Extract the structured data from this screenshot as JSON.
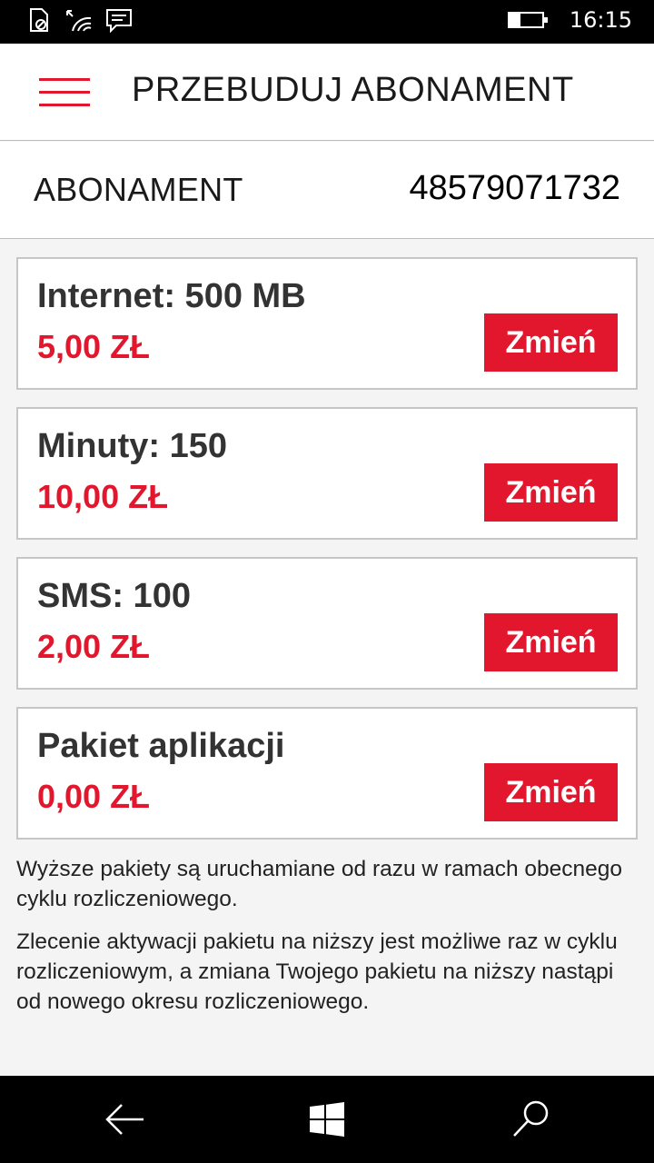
{
  "status_bar": {
    "time": "16:15",
    "battery_level": 0.35,
    "icons": [
      "do-not-disturb-icon",
      "wifi-icon",
      "message-icon"
    ]
  },
  "header": {
    "title": "PRZEBUDUJ ABONAMENT",
    "menu_icon": "hamburger-menu-icon",
    "accent_color": "#e2162d"
  },
  "subscription": {
    "label": "ABONAMENT",
    "number": "48579071732"
  },
  "packages": [
    {
      "name": "Internet: 500 MB",
      "price": "5,00 ZŁ",
      "button_label": "Zmień"
    },
    {
      "name": "Minuty: 150",
      "price": "10,00 ZŁ",
      "button_label": "Zmień"
    },
    {
      "name": "SMS: 100",
      "price": "2,00 ZŁ",
      "button_label": "Zmień"
    },
    {
      "name": "Pakiet aplikacji",
      "price": "0,00 ZŁ",
      "button_label": "Zmień"
    }
  ],
  "info": {
    "paragraph_1": "Wyższe pakiety są uruchamiane od razu w ramach obecnego cyklu rozliczeniowego.",
    "paragraph_2": "Zlecenie aktywacji pakietu na niższy jest możliwe raz w cyklu rozliczeniowym, a zmiana Twojego pakietu na niższy nastąpi od nowego okresu rozliczeniowego."
  },
  "nav_bar": {
    "icons": [
      "back-arrow-icon",
      "windows-start-icon",
      "search-icon"
    ]
  }
}
